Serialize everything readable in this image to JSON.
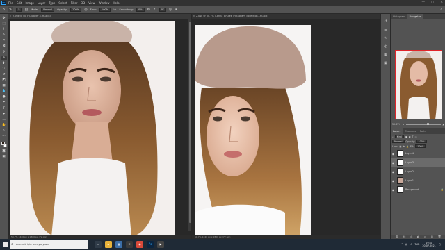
{
  "app": {
    "logo": "Ps",
    "menus": [
      "File",
      "Edit",
      "Image",
      "Layer",
      "Type",
      "Select",
      "Filter",
      "3D",
      "View",
      "Window",
      "Help"
    ],
    "window_controls": [
      "—",
      "□",
      "✕"
    ]
  },
  "options_bar": {
    "mode_label": "Mode:",
    "mode_value": "Normal",
    "opacity_label": "Opacity:",
    "opacity_value": "100%",
    "flow_label": "Flow:",
    "flow_value": "100%",
    "smoothing_label": "Smoothing:",
    "smoothing_value": "0%",
    "angle_value": "0°",
    "brush_size": "5"
  },
  "documents": [
    {
      "tab_title": "2.psd @ 50.7% (Layer 3, RGB/8)",
      "footer": "50.7%   1440 px x 1800 px (72 ppi)"
    },
    {
      "tab_title": "2.psd @ 50.7% (Lanna_Bhulek_Instagram_collection...RGB/8)",
      "footer": "50.7%   1440 px x 1800 px (72 ppi)"
    }
  ],
  "navigator": {
    "tabs": [
      "Histogram",
      "Navigator"
    ],
    "active_tab": "Navigator",
    "zoom": "50.67%"
  },
  "layers": {
    "tabs": [
      "Layers",
      "Channels",
      "Paths"
    ],
    "active_tab": "Layers",
    "filter_kind": "Kind",
    "blend_mode": "Normal",
    "opacity_label": "Opacity:",
    "opacity_value": "100%",
    "lock_label": "Lock:",
    "fill_label": "Fill:",
    "fill_value": "100%",
    "items": [
      {
        "name": "Layer 4",
        "selected": false,
        "thumb": "white"
      },
      {
        "name": "Layer 3",
        "selected": true,
        "thumb": "white"
      },
      {
        "name": "Layer 2",
        "selected": false,
        "thumb": "white"
      },
      {
        "name": "Layer 1",
        "selected": false,
        "thumb": "photo"
      },
      {
        "name": "Background",
        "selected": false,
        "thumb": "white",
        "locked": true
      }
    ],
    "footer_icons": [
      "link-icon",
      "fx-icon",
      "mask-icon",
      "adjustment-icon",
      "folder-icon",
      "new-layer-icon",
      "trash-icon"
    ]
  },
  "taskbar": {
    "search_placeholder": "Aramak için buraya yazın",
    "time": "19:41",
    "date": "20.07.2021",
    "language": "TUR",
    "accent": "#1f2a36"
  }
}
